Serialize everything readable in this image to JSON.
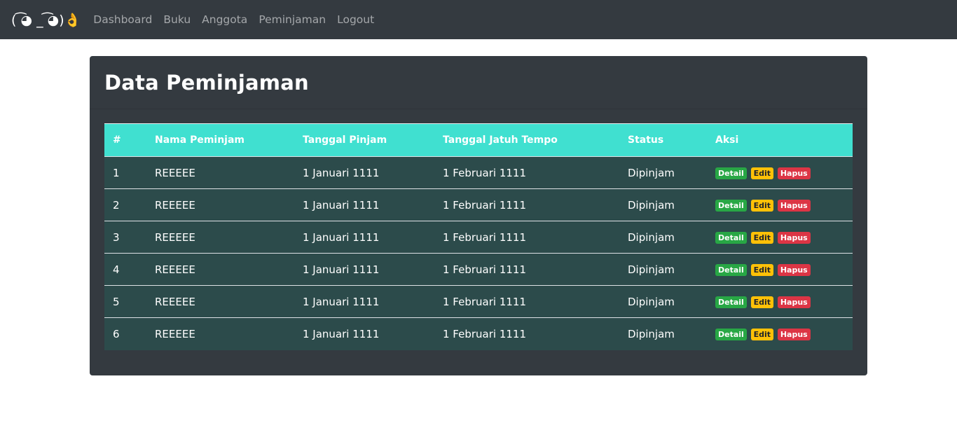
{
  "navbar": {
    "brand": "( ͡◕ _ ͡◕)👌",
    "links": [
      "Dashboard",
      "Buku",
      "Anggota",
      "Peminjaman",
      "Logout"
    ]
  },
  "page": {
    "title": "Data Peminjaman"
  },
  "table": {
    "headers": [
      "#",
      "Nama Peminjam",
      "Tanggal Pinjam",
      "Tanggal Jatuh Tempo",
      "Status",
      "Aksi"
    ],
    "rows": [
      {
        "no": "1",
        "nama": "REEEEE",
        "pinjam": "1 Januari 1111",
        "tempo": "1 Februari 1111",
        "status": "Dipinjam"
      },
      {
        "no": "2",
        "nama": "REEEEE",
        "pinjam": "1 Januari 1111",
        "tempo": "1 Februari 1111",
        "status": "Dipinjam"
      },
      {
        "no": "3",
        "nama": "REEEEE",
        "pinjam": "1 Januari 1111",
        "tempo": "1 Februari 1111",
        "status": "Dipinjam"
      },
      {
        "no": "4",
        "nama": "REEEEE",
        "pinjam": "1 Januari 1111",
        "tempo": "1 Februari 1111",
        "status": "Dipinjam"
      },
      {
        "no": "5",
        "nama": "REEEEE",
        "pinjam": "1 Januari 1111",
        "tempo": "1 Februari 1111",
        "status": "Dipinjam"
      },
      {
        "no": "6",
        "nama": "REEEEE",
        "pinjam": "1 Januari 1111",
        "tempo": "1 Februari 1111",
        "status": "Dipinjam"
      }
    ],
    "actions": {
      "detail": "Detail",
      "edit": "Edit",
      "hapus": "Hapus"
    }
  },
  "colors": {
    "navbar": "#343a40",
    "card": "#343a40",
    "header_row": "#40e0d0",
    "body_row": "#2c4b4b",
    "success": "#28a745",
    "warning": "#ffc107",
    "danger": "#dc3545"
  }
}
